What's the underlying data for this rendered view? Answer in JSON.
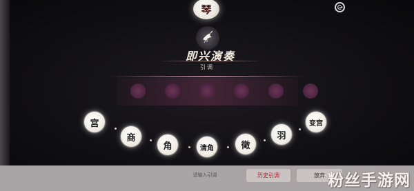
{
  "header": {
    "instrument": "琴",
    "exit_icon": "exit-icon"
  },
  "mode": {
    "emblem_icon": "crane-icon",
    "title": "即兴演奏",
    "subtitle": "引调"
  },
  "notes": [
    {
      "label": "宫"
    },
    {
      "label": "商"
    },
    {
      "label": "角"
    },
    {
      "label": "清角"
    },
    {
      "label": "徵"
    },
    {
      "label": "羽"
    },
    {
      "label": "变宫"
    }
  ],
  "note_band": {
    "slot_count": 6,
    "color": "#4a2340"
  },
  "bottom_bar": {
    "input_placeholder": "请输入引调",
    "history_label": "历史引调",
    "give_up_label": "放弃",
    "history_color": "#b0202a"
  },
  "watermark": "粉丝手游网"
}
